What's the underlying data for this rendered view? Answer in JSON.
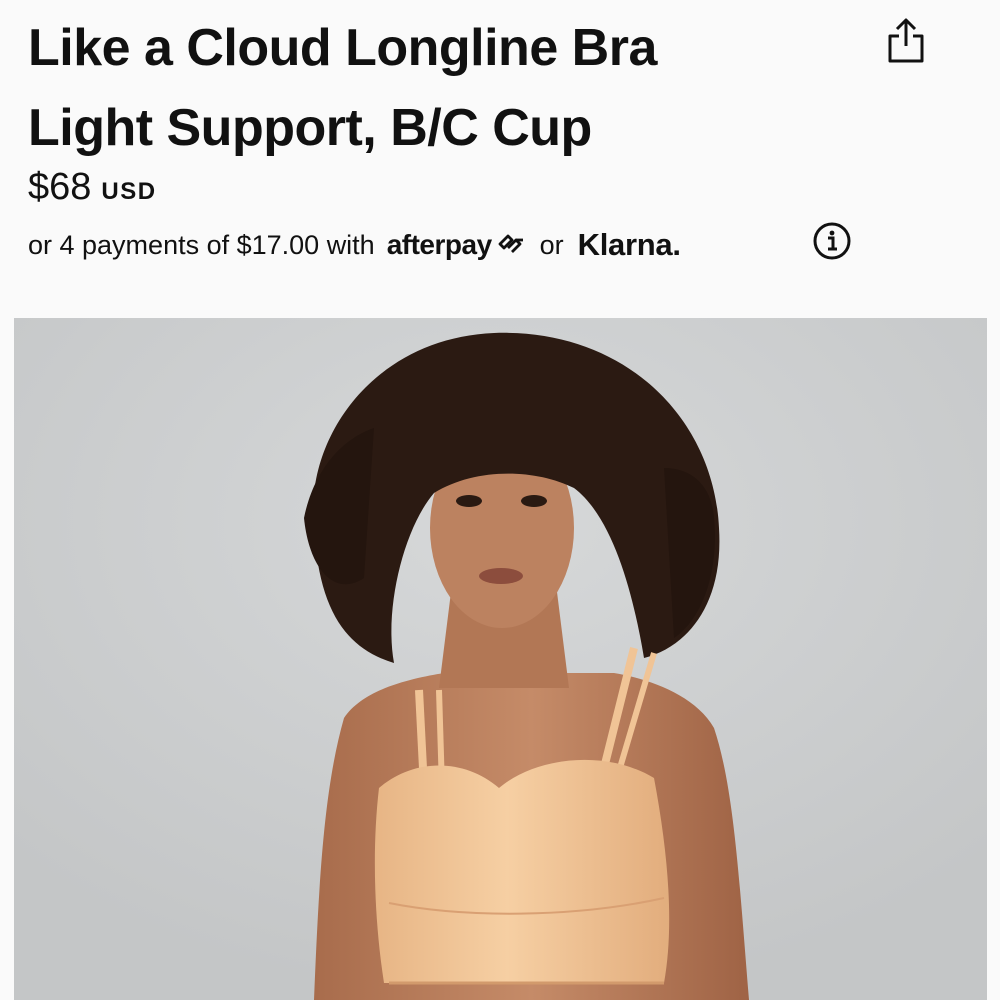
{
  "product": {
    "title_line1": "Like a Cloud Longline Bra",
    "title_line2": "Light Support, B/C Cup",
    "price": "$68",
    "currency": "USD"
  },
  "payments": {
    "text": "or 4 payments of $17.00 with",
    "afterpay_label": "afterpay",
    "or_label": "or",
    "klarna_label": "Klarna."
  },
  "icons": {
    "share": "share-icon",
    "info": "info-icon",
    "afterpay": "afterpay-arrows-icon"
  },
  "colors": {
    "background": "#fafafa",
    "text": "#111111",
    "image_backdrop": "#cbcdce",
    "garment": "#f3c89a",
    "hair": "#2b1a12",
    "skin": "#b97e5c"
  },
  "image": {
    "subject": "model-wearing-bra"
  }
}
